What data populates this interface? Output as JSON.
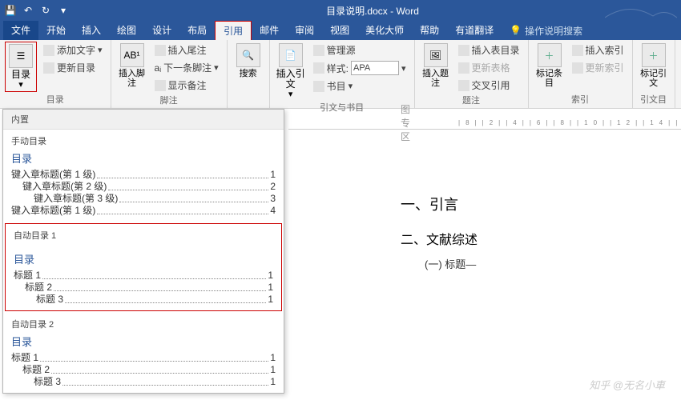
{
  "titlebar": {
    "doc_title": "目录说明.docx - Word"
  },
  "menu": {
    "file": "文件",
    "items": [
      "开始",
      "插入",
      "绘图",
      "设计",
      "布局",
      "引用",
      "邮件",
      "审阅",
      "视图",
      "美化大师",
      "帮助",
      "有道翻译"
    ],
    "active": "引用",
    "tellme": "操作说明搜索"
  },
  "ribbon": {
    "toc": {
      "big": "目录",
      "add_text": "添加文字",
      "update": "更新目录",
      "label": "目录"
    },
    "footnote": {
      "big": "插入脚注",
      "endnote": "插入尾注",
      "next": "下一条脚注",
      "show": "显示备注",
      "label": "脚注"
    },
    "search": {
      "big": "搜索"
    },
    "citation": {
      "big": "插入引文",
      "manage": "管理源",
      "style_lbl": "样式:",
      "style_val": "APA",
      "bib": "书目",
      "label": "引文与书目"
    },
    "caption": {
      "big": "插入题注",
      "tof": "插入表目录",
      "update_tbl": "更新表格",
      "xref": "交叉引用",
      "label": "题注"
    },
    "index": {
      "big": "标记条目",
      "ins": "插入索引",
      "upd": "更新索引",
      "label": "索引"
    },
    "cit2": {
      "big": "标记引文",
      "label": "引文目"
    }
  },
  "dropdown": {
    "builtin": "内置",
    "manual": {
      "header": "手动目录",
      "title": "目录",
      "lines": [
        {
          "t": "键入章标题(第 1 级)",
          "p": "1",
          "indent": 0
        },
        {
          "t": "键入章标题(第 2 级)",
          "p": "2",
          "indent": 1
        },
        {
          "t": "键入章标题(第 3 级)",
          "p": "3",
          "indent": 2
        },
        {
          "t": "键入章标题(第 1 级)",
          "p": "4",
          "indent": 0
        }
      ]
    },
    "auto1": {
      "header": "自动目录 1",
      "title": "目录",
      "lines": [
        {
          "t": "标题 1",
          "p": "1",
          "indent": 0
        },
        {
          "t": "标题 2",
          "p": "1",
          "indent": 1
        },
        {
          "t": "标题 3",
          "p": "1",
          "indent": 2
        }
      ]
    },
    "auto2": {
      "header": "自动目录 2",
      "title": "目录",
      "lines": [
        {
          "t": "标题 1",
          "p": "1",
          "indent": 0
        },
        {
          "t": "标题 2",
          "p": "1",
          "indent": 1
        },
        {
          "t": "标题 3",
          "p": "1",
          "indent": 2
        }
      ]
    }
  },
  "doc": {
    "ruler_hint": "图专区",
    "h1": "一、引言",
    "h2": "二、文献综述",
    "h3": "(一) 标题—"
  },
  "watermark": "知乎 @无名小車"
}
